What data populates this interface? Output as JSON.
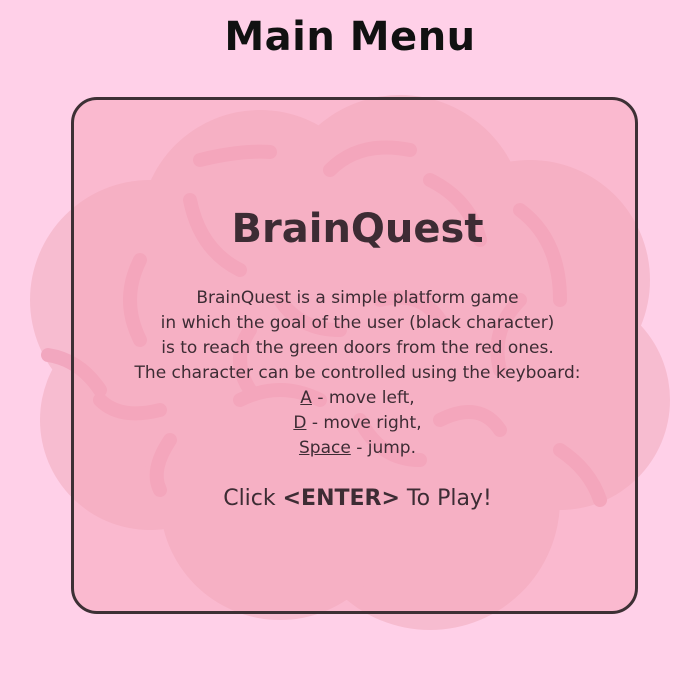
{
  "header": {
    "title": "Main Menu"
  },
  "panel": {
    "game_title": "BrainQuest",
    "description_lines": [
      "BrainQuest is a simple platform game",
      "in which the goal of the user (black character)",
      "is to reach the green doors from the red ones.",
      "The character can be controlled using the keyboard:"
    ],
    "controls": [
      {
        "key": "A",
        "action": " - move left,"
      },
      {
        "key": "D",
        "action": " - move right,"
      },
      {
        "key": "Space",
        "action": " - jump."
      }
    ],
    "prompt": {
      "prefix": "Click ",
      "key": "<ENTER>",
      "suffix": " To Play!"
    }
  },
  "colors": {
    "background": "#ffd0e8",
    "brain": "#f7b8cc",
    "panel_border": "#3d3035",
    "text": "#3d2c34"
  },
  "icons": {
    "background_art": "brain-icon"
  }
}
